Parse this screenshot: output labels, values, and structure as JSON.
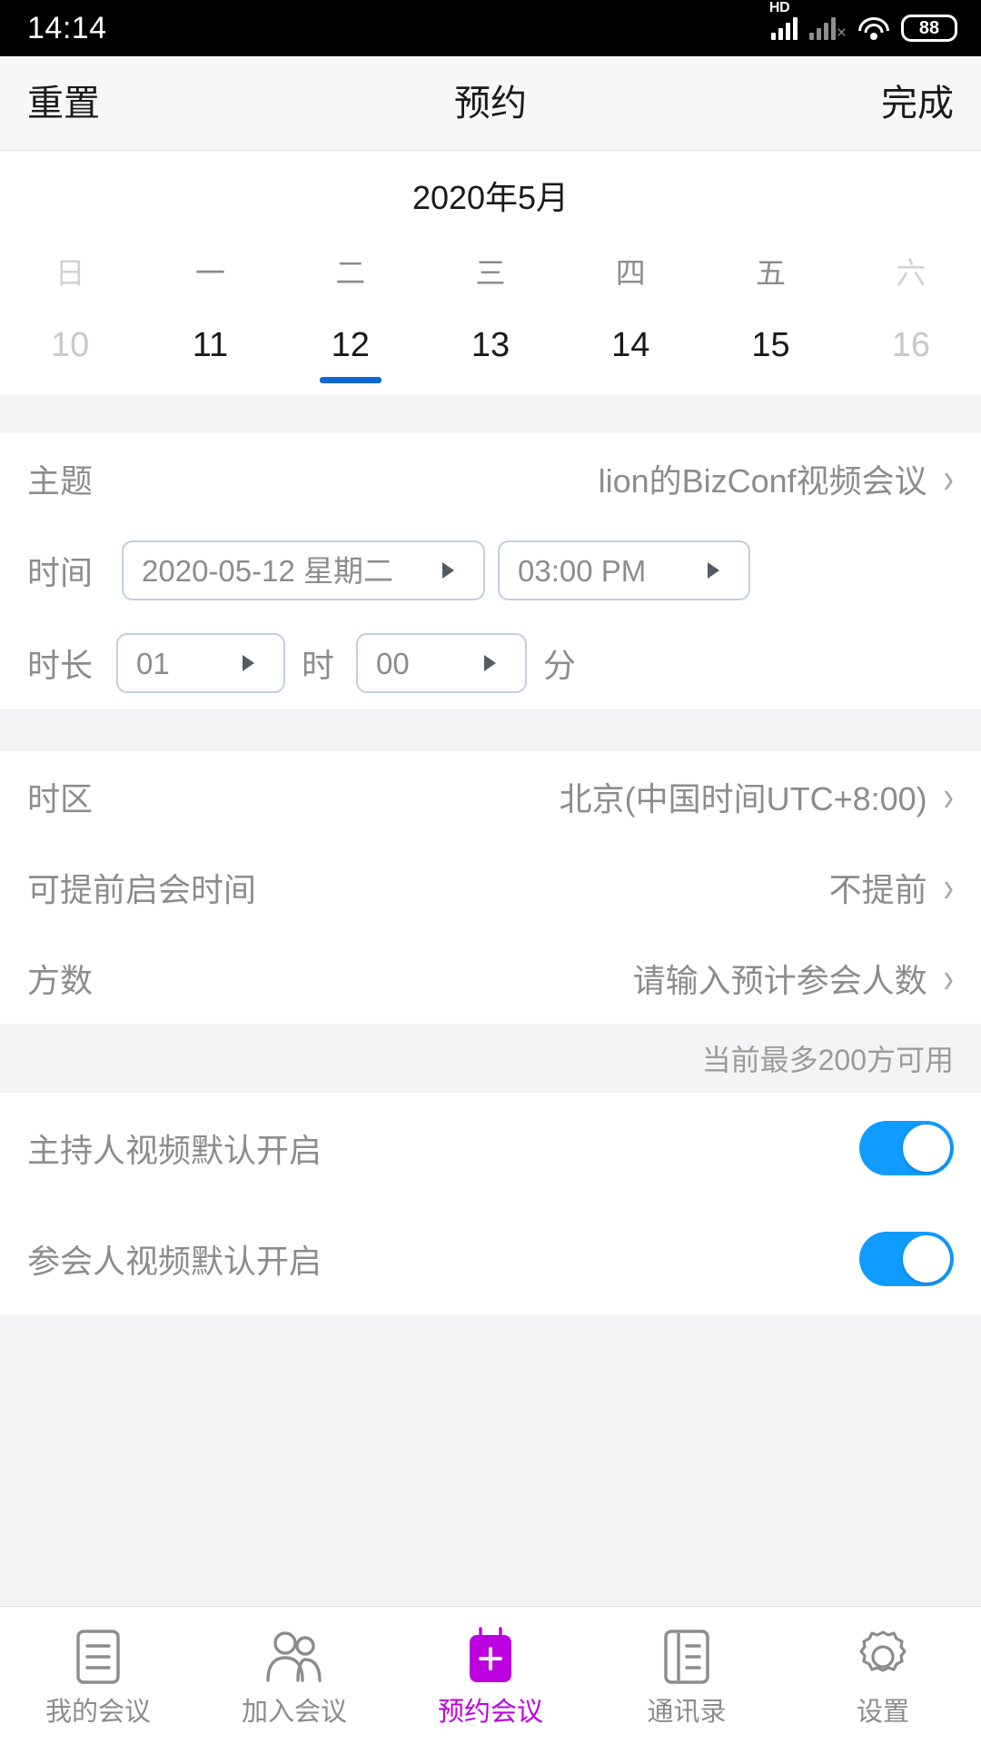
{
  "status_bar": {
    "time": "14:14",
    "network_label": "HD",
    "battery": "88",
    "icons": [
      "signal-hd-icon",
      "signal-no-service-icon",
      "wifi-icon",
      "battery-icon"
    ]
  },
  "nav_bar": {
    "left_button": "重置",
    "title": "预约",
    "right_button": "完成"
  },
  "calendar": {
    "month_label": "2020年5月",
    "weekdays": [
      {
        "label": "日",
        "muted": true
      },
      {
        "label": "一",
        "muted": false
      },
      {
        "label": "二",
        "muted": false
      },
      {
        "label": "三",
        "muted": false
      },
      {
        "label": "四",
        "muted": false
      },
      {
        "label": "五",
        "muted": false
      },
      {
        "label": "六",
        "muted": true
      }
    ],
    "days": [
      {
        "label": "10",
        "muted": true,
        "selected": false
      },
      {
        "label": "11",
        "muted": false,
        "selected": false
      },
      {
        "label": "12",
        "muted": false,
        "selected": true
      },
      {
        "label": "13",
        "muted": false,
        "selected": false
      },
      {
        "label": "14",
        "muted": false,
        "selected": false
      },
      {
        "label": "15",
        "muted": false,
        "selected": false
      },
      {
        "label": "16",
        "muted": true,
        "selected": false
      }
    ],
    "selected_accent": "#1268d3"
  },
  "form": {
    "topic": {
      "label": "主题",
      "value": "lion的BizConf视频会议",
      "chevron": "›"
    },
    "time": {
      "label": "时间",
      "date_value": "2020-05-12 星期二",
      "time_value": "03:00 PM"
    },
    "duration": {
      "label": "时长",
      "hours_value": "01",
      "hours_unit": "时",
      "minutes_value": "00",
      "minutes_unit": "分"
    },
    "timezone": {
      "label": "时区",
      "value": "北京(中国时间UTC+8:00)",
      "chevron": "›"
    },
    "early_start": {
      "label": "可提前启会时间",
      "value": "不提前",
      "chevron": "›"
    },
    "party_count": {
      "label": "方数",
      "placeholder": "请输入预计参会人数",
      "chevron": "›"
    },
    "capacity_hint": "当前最多200方可用",
    "host_video": {
      "label": "主持人视频默认开启",
      "enabled": true
    },
    "participant_video": {
      "label": "参会人视频默认开启",
      "enabled": true
    },
    "switch_on_color": "#0f9bff"
  },
  "tab_bar": {
    "active_color": "#bc00e0",
    "items": [
      {
        "label": "我的会议",
        "icon": "document-list-icon",
        "active": false
      },
      {
        "label": "加入会议",
        "icon": "people-icon",
        "active": false
      },
      {
        "label": "预约会议",
        "icon": "add-calendar-icon",
        "active": true
      },
      {
        "label": "通讯录",
        "icon": "contacts-book-icon",
        "active": false
      },
      {
        "label": "设置",
        "icon": "gear-icon",
        "active": false
      }
    ]
  }
}
